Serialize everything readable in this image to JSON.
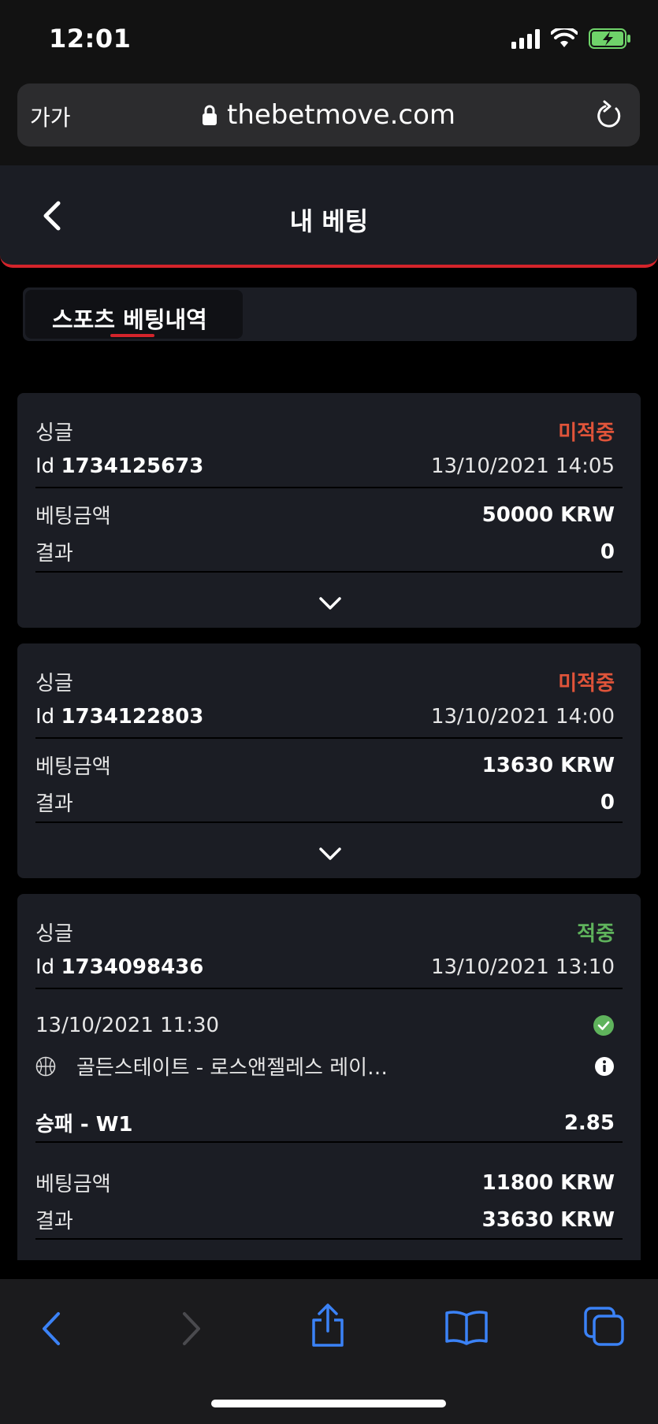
{
  "status_bar": {
    "time": "12:01"
  },
  "browser": {
    "text_size_label": "가가",
    "url": "thebetmove.com"
  },
  "header": {
    "title": "내 베팅"
  },
  "tabs": [
    {
      "label": "스포츠 베팅내역",
      "active": true
    }
  ],
  "bets": [
    {
      "type": "싱글",
      "status": "미적중",
      "id_prefix": "Id",
      "id": "1734125673",
      "datetime": "13/10/2021 14:05",
      "stake_label": "베팅금액",
      "stake": "50000 KRW",
      "result_label": "결과",
      "result": "0"
    },
    {
      "type": "싱글",
      "status": "미적중",
      "id_prefix": "Id",
      "id": "1734122803",
      "datetime": "13/10/2021 14:00",
      "stake_label": "베팅금액",
      "stake": "13630 KRW",
      "result_label": "결과",
      "result": "0"
    },
    {
      "type": "싱글",
      "status": "적중",
      "id_prefix": "Id",
      "id": "1734098436",
      "datetime": "13/10/2021 13:10",
      "event_datetime": "13/10/2021 11:30",
      "event_name": "골든스테이트 - 로스앤젤레스 레이…",
      "market": "승패 - W1",
      "odds": "2.85",
      "stake_label": "베팅금액",
      "stake": "11800 KRW",
      "result_label": "결과",
      "result": "33630 KRW"
    }
  ],
  "colors": {
    "accent_red": "#d4242b",
    "status_lost": "#e0543a",
    "status_won": "#5fb35c",
    "ios_blue": "#3b82f6"
  },
  "icons": [
    "signal-icon",
    "wifi-icon",
    "battery-icon",
    "lock-icon",
    "reload-icon",
    "back-arrow-icon",
    "chevron-down-icon",
    "check-circle-icon",
    "basketball-icon",
    "info-icon",
    "share-icon",
    "bookmarks-icon",
    "tabs-icon"
  ]
}
